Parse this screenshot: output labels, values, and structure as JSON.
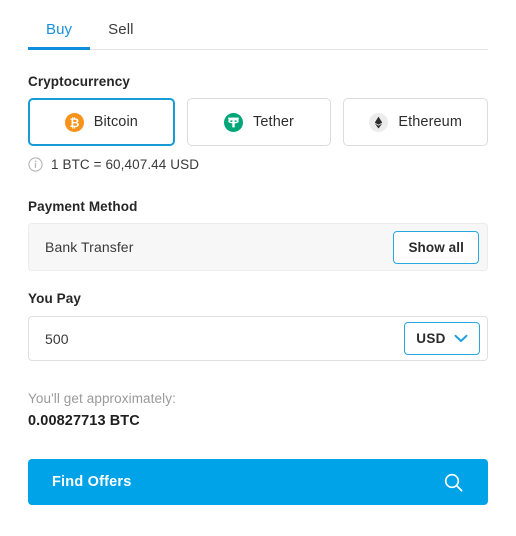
{
  "tabs": [
    {
      "id": "buy",
      "label": "Buy",
      "active": true
    },
    {
      "id": "sell",
      "label": "Sell",
      "active": false
    }
  ],
  "cryptocurrency": {
    "label": "Cryptocurrency",
    "options": [
      {
        "code": "BTC",
        "name": "Bitcoin",
        "icon": "bitcoin-icon",
        "color": "#f7931a",
        "selected": true
      },
      {
        "code": "USDT",
        "name": "Tether",
        "icon": "tether-icon",
        "color": "#00a578",
        "selected": false
      },
      {
        "code": "ETH",
        "name": "Ethereum",
        "icon": "ethereum-icon",
        "color": "#ececec",
        "selected": false
      }
    ]
  },
  "rate": {
    "icon": "info-icon",
    "text": "1 BTC = 60,407.44 USD"
  },
  "payment_method": {
    "label": "Payment Method",
    "selected": "Bank Transfer",
    "show_all_label": "Show all"
  },
  "you_pay": {
    "label": "You Pay",
    "amount": "500",
    "placeholder": "0",
    "currency": "USD"
  },
  "result": {
    "label": "You'll get approximately:",
    "value": "0.00827713 BTC"
  },
  "cta": {
    "label": "Find Offers",
    "icon": "search-icon"
  },
  "colors": {
    "accent_blue": "#00a3e8",
    "tab_active": "#1890d9",
    "tab_underline": "#0d8fdb",
    "selected_border": "#169bd7",
    "outline_blue": "#29a8e0",
    "bitcoin_orange": "#f7931a",
    "tether_green": "#00a578",
    "muted_text": "#9a9a9a",
    "panel_bg": "#f7f7f7"
  }
}
